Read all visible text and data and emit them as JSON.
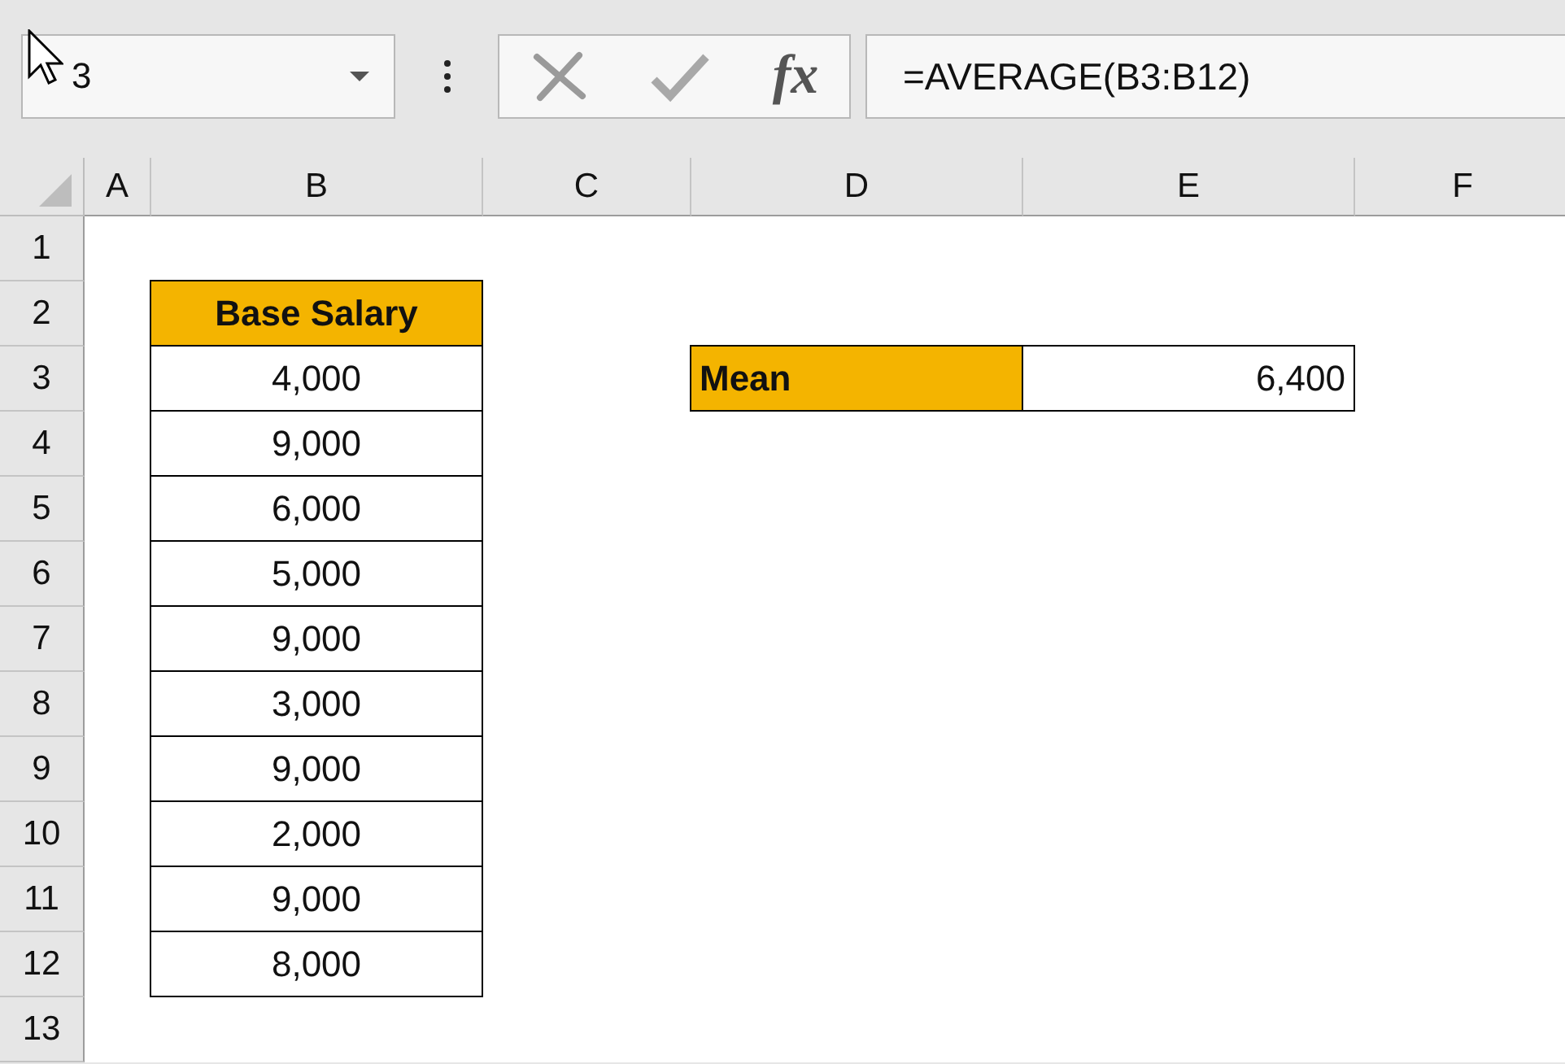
{
  "name_box": {
    "value": "3"
  },
  "formula_bar": {
    "insert_function": "fx",
    "formula": "=AVERAGE(B3:B12)"
  },
  "columns": [
    "A",
    "B",
    "C",
    "D",
    "E",
    "F"
  ],
  "rows": [
    "1",
    "2",
    "3",
    "4",
    "5",
    "6",
    "7",
    "8",
    "9",
    "10",
    "11",
    "12",
    "13"
  ],
  "salary_table": {
    "header": "Base Salary",
    "values": [
      "4,000",
      "9,000",
      "6,000",
      "5,000",
      "9,000",
      "3,000",
      "9,000",
      "2,000",
      "9,000",
      "8,000"
    ]
  },
  "mean": {
    "label": "Mean",
    "value": "6,400"
  }
}
